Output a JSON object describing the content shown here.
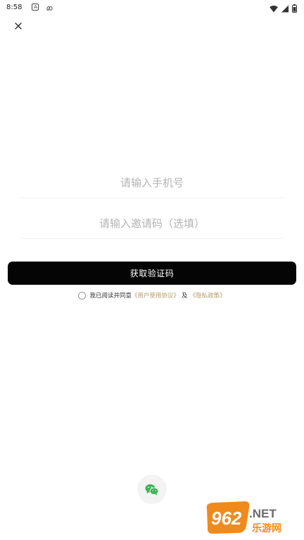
{
  "status_bar": {
    "time": "8:58",
    "icons": [
      "a-icon",
      "infinity-icon",
      "wifi-icon",
      "signal-icon",
      "battery-icon"
    ]
  },
  "header": {
    "close_icon": "close-icon"
  },
  "form": {
    "phone_placeholder": "请输入手机号",
    "phone_value": "",
    "invite_placeholder": "请输入邀请码（选填）",
    "invite_value": "",
    "submit_label": "获取验证码"
  },
  "agreement": {
    "checked": false,
    "prefix": "我已阅读并同意",
    "user_agreement": "《用户使用协议》",
    "conjunction": "及",
    "privacy_policy": "《隐私政策》"
  },
  "third_party_login": {
    "icon": "wechat-icon"
  },
  "watermark": {
    "text": "962.NET",
    "subtext": "乐游网"
  },
  "colors": {
    "primary_button": "#050505",
    "link": "#b39a6e",
    "placeholder": "#b4b4b4",
    "wechat_green": "#3fb155",
    "watermark_orange": "#f08a1c"
  }
}
